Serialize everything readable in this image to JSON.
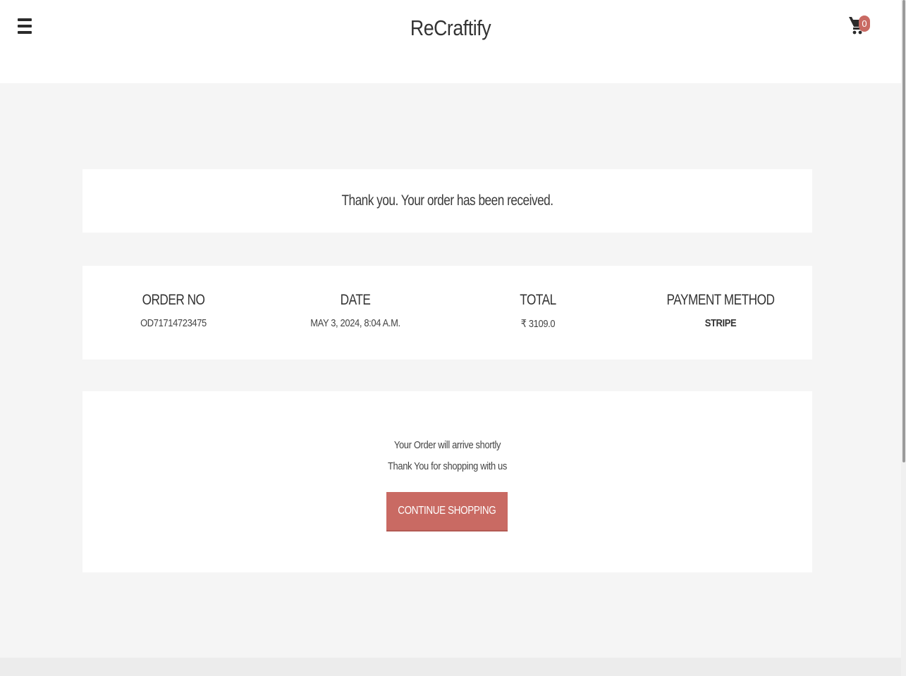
{
  "header": {
    "brand": "ReCraftify",
    "cart_count": "0"
  },
  "icons": {
    "menu": "hamburger-menu-icon",
    "cart": "shopping-cart-icon"
  },
  "confirmation": {
    "message": "Thank you. Your order has been received."
  },
  "order": {
    "columns": [
      {
        "label": "ORDER NO",
        "value": "OD71714723475"
      },
      {
        "label": "DATE",
        "value": "MAY 3, 2024, 8:04 A.M."
      },
      {
        "label": "TOTAL",
        "value": "₹ 3109.0"
      },
      {
        "label": "PAYMENT METHOD",
        "value": "STRIPE"
      }
    ]
  },
  "message": {
    "line1": "Your Order will arrive shortly",
    "line2": "Thank You for shopping with us",
    "button_label": "CONTINUE SHOPPING"
  },
  "colors": {
    "accent": "#c96a63",
    "background": "#f5f5f5",
    "panel": "#ffffff"
  }
}
